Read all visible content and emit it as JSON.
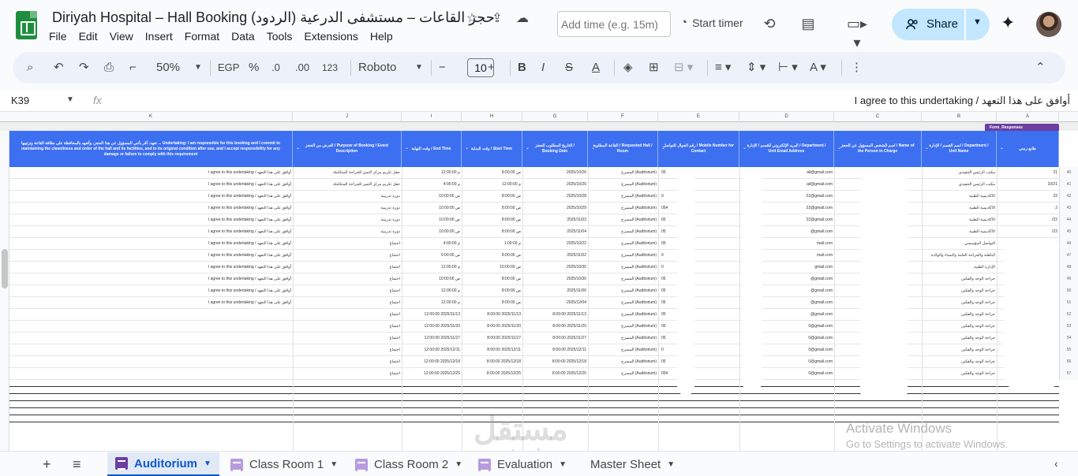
{
  "title": {
    "doc_title": "Diriyah Hospital – Hall Booking  (الردود)  حجز القاعات – مستشفى الدرعية",
    "menu": [
      "File",
      "Edit",
      "View",
      "Insert",
      "Format",
      "Data",
      "Tools",
      "Extensions",
      "Help"
    ]
  },
  "header": {
    "time_placeholder": "Add time (e.g. 15m)",
    "start_timer": "Start timer",
    "share": "Share"
  },
  "toolbar": {
    "zoom": "50%",
    "currency": "EGP",
    "percent": "%",
    "dec_less": ".0",
    "dec_more": ".00",
    "number_fmt": "123",
    "font": "Roboto",
    "font_size": "10",
    "bold": "B",
    "italic": "I",
    "strike": "S",
    "text_color": "A"
  },
  "formula_bar": {
    "cell_ref": "K39",
    "fx": "fx",
    "value": "I agree to this undertaking / أوافق على هذا التعهد"
  },
  "columns": [
    "K",
    "J",
    "I",
    "H",
    "G",
    "F",
    "E",
    "D",
    "C",
    "B",
    "A"
  ],
  "form_tag": "Form_Responses",
  "headers": {
    "k": "تعهد: أقر بأنني المسؤول عن هذا الحجز، وأتعهد بالمحافظة على نظافة القاعة وترتيبها ... Undertaking: I am responsible for this booking and I commit to maintaining the cleanliness and order of the hall and its facilities, and to its original condition after use, and I accept responsibility for any damage or failure to comply with this requirement",
    "j": "الغرض من الحجز / Purpose of Booking / Event Description",
    "i": "وقت النهاية / End Time",
    "h": "وقت البداية / Start Time",
    "g": "التاريخ المطلوب للحجز / Booking Date",
    "f": "القاعة المطلوبة / Requested Hall / Room",
    "e": "رقم الجوال للتواصل / Mobile Number for Contact",
    "d": "البريد الإلكتروني للقسم / الإدارة / Department / Unit Email Address",
    "c": "اسم الشخص المسؤول عن الحجز / Name of the Person in Charge",
    "b": "اسم القسم / الإدارة / Department / Unit Name",
    "a": "طابع زمني"
  },
  "rows": [
    {
      "n": "40",
      "k": "I agree to this undertaking / أوافق على هذا التعهد",
      "j": "حفل تكريم مركز التميز للجراحة المتكاملة",
      "i": "12:00:00 م",
      "h": "8:00:00 ص",
      "g": "2025/10/26",
      "f": "المسرح (Auditorium)",
      "e": "05",
      "d": "ail@gmail.com",
      "b": "مكتب الرئيس التنفيذي",
      "a": "21"
    },
    {
      "n": "41",
      "k": "I agree to this undertaking / أوافق على هذا التعهد",
      "j": "حفل تكريم مركز التميز للجراحة المتكاملة",
      "i": "4:00:00 م",
      "h": "12:00:00 م",
      "g": "2025/10/26",
      "f": "المسرح (Auditorium)",
      "e": "",
      "d": "ail@gmail.com",
      "b": "مكتب الرئيس التنفيذي",
      "a": "10/21"
    },
    {
      "n": "42",
      "k": "I agree to this undertaking / أوافق على هذا التعهد",
      "j": "دورة تدريبية",
      "i": "10:00:00 ص",
      "h": "8:00:00 ص",
      "g": "2025/10/28",
      "f": "المسرح (Auditorium)",
      "e": "0",
      "d": "22@gmail.com",
      "b": "الأكاديمية الطبية",
      "a": "22"
    },
    {
      "n": "43",
      "k": "I agree to this undertaking / أوافق على هذا التعهد",
      "j": "دورة تدريبية",
      "i": "10:00:00 ص",
      "h": "8:00:00 ص",
      "g": "2025/10/29",
      "f": "المسرح (Auditorium)",
      "e": "054",
      "d": "22@gmail.com",
      "b": "الأكاديمية الطبية",
      "a": "2"
    },
    {
      "n": "44",
      "k": "I agree to this undertaking / أوافق على هذا التعهد",
      "j": "دورة تدريبية",
      "i": "10:00:00 ص",
      "h": "8:00:00 ص",
      "g": "2025/11/03",
      "f": "المسرح (Auditorium)",
      "e": "05",
      "d": "22@gmail.com",
      "b": "الأكاديمية الطبية",
      "a": "/22"
    },
    {
      "n": "45",
      "k": "I agree to this undertaking / أوافق على هذا التعهد",
      "j": "دورة تدريبية",
      "i": "10:00:00 ص",
      "h": "8:00:00 ص",
      "g": "2025/11/04",
      "f": "المسرح (Auditorium)",
      "e": "05",
      "d": "@gmail.com",
      "b": "الأكاديمية الطبية",
      "a": "/22"
    },
    {
      "n": "46",
      "k": "I agree to this undertaking / أوافق على هذا التعهد",
      "j": "اجتماع",
      "i": "4:00:00 م",
      "h": "1:00:00 م",
      "g": "2025/10/22",
      "f": "المسرح (Auditorium)",
      "e": "05",
      "d": "mail.com",
      "b": "التواصل المؤسسي",
      "a": "22"
    },
    {
      "n": "47",
      "k": "I agree to this undertaking / أوافق على هذا التعهد",
      "j": "اجتماع",
      "i": "9:00:00 ص",
      "h": "8:00:00 ص",
      "g": "2025/11/02",
      "f": "المسرح (Auditorium)",
      "e": "0",
      "d": "mail.com",
      "b": "الباطنة والجراحة العامة والنساء والولادة",
      "a": "22"
    },
    {
      "n": "48",
      "k": "I agree to this undertaking / أوافق على هذا التعهد",
      "j": "اجتماع",
      "i": "12:00:00 م",
      "h": "10:00:00 ص",
      "g": "2025/10/30",
      "f": "المسرح (Auditorium)",
      "e": "0",
      "d": "gmail.com",
      "b": "الإدارة الطبية",
      "a": "/23"
    },
    {
      "n": "49",
      "k": "I agree to this undertaking / أوافق على هذا التعهد",
      "j": "اجتماع",
      "i": "10:00:00 ص",
      "h": "8:00:00 ص",
      "g": "2025/10/30",
      "f": "المسرح (Auditorium)",
      "e": "05",
      "d": "@gmail.com",
      "b": "جراحة الوجه والفكين",
      "a": "/24"
    },
    {
      "n": "50",
      "k": "I agree to this undertaking / أوافق على هذا التعهد",
      "j": "اجتماع",
      "i": "12:00:00 م",
      "h": "8:00:00 ص",
      "g": "2025/11/06",
      "f": "المسرح (Auditorium)",
      "e": "05",
      "d": "@gmail.com",
      "b": "جراحة الوجه والفكين",
      "a": "/24"
    },
    {
      "n": "51",
      "k": "I agree to this undertaking / أوافق على هذا التعهد",
      "j": "اجتماع",
      "i": "12:00:00 م",
      "h": "8:00:00 ص",
      "g": "2025/12/04",
      "f": "المسرح (Auditorium)",
      "e": "05",
      "d": "@gmail.com",
      "b": "جراحة الوجه والفكين",
      "a": "/25"
    },
    {
      "n": "52",
      "k": "",
      "j": "اجتماع",
      "i": "12:00:00 2025/11/13",
      "h": "8:00:00 2025/11/13",
      "g": "8:00:00 2025/11/13",
      "f": "المسرح (Auditorium)",
      "e": "05",
      "d": "@gmail.com",
      "b": "جراحة الوجه والفكين",
      "a": ""
    },
    {
      "n": "53",
      "k": "",
      "j": "اجتماع",
      "i": "12:00:00 2025/11/20",
      "h": "8:00:00 2025/11/20",
      "g": "8:00:00 2025/11/20",
      "f": "المسرح (Auditorium)",
      "e": "05",
      "d": "0@gmail.com",
      "b": "جراحة الوجه والفكين",
      "a": ""
    },
    {
      "n": "54",
      "k": "",
      "j": "اجتماع",
      "i": "12:00:00 2025/11/27",
      "h": "8:00:00 2025/11/27",
      "g": "8:00:00 2025/11/27",
      "f": "المسرح (Auditorium)",
      "e": "05",
      "d": "0@gmail.com",
      "b": "جراحة الوجه والفكين",
      "a": ""
    },
    {
      "n": "55",
      "k": "",
      "j": "اجتماع",
      "i": "12:00:00 2025/12/11",
      "h": "8:00:00 2025/12/11",
      "g": "8:00:00 2025/12/11",
      "f": "المسرح (Auditorium)",
      "e": "0",
      "d": "0@gmail.com",
      "b": "جراحة الوجه والفكين",
      "a": ""
    },
    {
      "n": "56",
      "k": "",
      "j": "اجتماع",
      "i": "12:00:00 2025/12/18",
      "h": "8:00:00 2025/12/18",
      "g": "8:00:00 2025/12/18",
      "f": "المسرح (Auditorium)",
      "e": "05",
      "d": "0@gmail.com",
      "b": "جراحة الوجه والفكين",
      "a": ""
    },
    {
      "n": "57",
      "k": "",
      "j": "اجتماع",
      "i": "12:00:00 2025/12/25",
      "h": "8:00:00 2025/12/25",
      "g": "8:00:00 2025/12/25",
      "f": "المسرح (Auditorium)",
      "e": "054",
      "d": "0@gmail.com",
      "b": "جراحة الوجه والفكين",
      "a": ""
    }
  ],
  "tabs": [
    "Auditorium",
    "Class Room 1",
    "Class Room 2",
    "Evaluation",
    "Master Sheet"
  ],
  "watermark": {
    "big": "مستقل",
    "small": "mostaql.com"
  },
  "activate": {
    "line1": "Activate Windows",
    "line2": "Go to Settings to activate Windows."
  }
}
